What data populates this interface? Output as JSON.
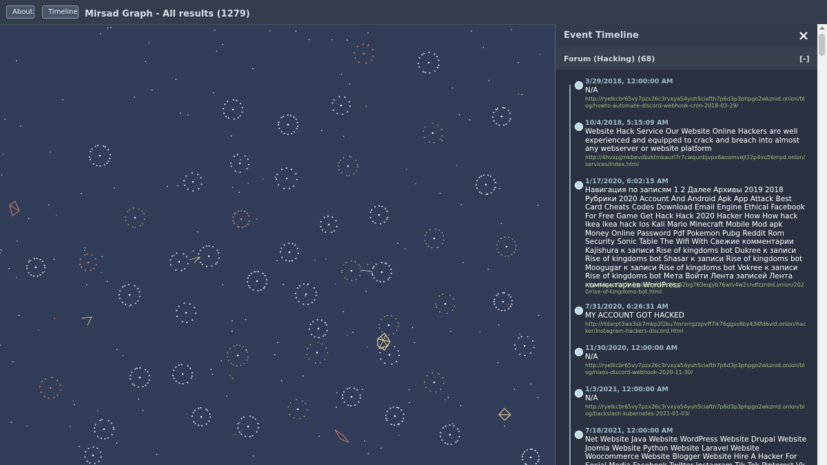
{
  "toolbar": {
    "about_label": "About",
    "timeline_label": "Timeline"
  },
  "header": {
    "title": "Mirsad Graph - All results (1279)"
  },
  "panel": {
    "title": "Event Timeline",
    "close_icon": "close-icon",
    "group": {
      "label": "Forum (Hacking) (68)",
      "toggle": "[-]"
    },
    "events": [
      {
        "date": "3/29/2018, 12:00:00 AM",
        "title": "N/A",
        "url": "http://ryelkcbr65vy7pzx26c3rvxya54yuh5ciafth7p6d3p3phpgo2wkznid.onion/blog/howto-automate-discord-webhook-cron-2018-03-29/"
      },
      {
        "date": "10/4/2018, 5:15:09 AM",
        "title": "Website Hack Service Our Website Online Hackers are well experienced and equipped to crack and breach into almost any webserver or website platform",
        "url": "http://4hvxpjjmkbevdbzktmkaurl7r7cwqunbjvpx6aoomvejl22p4vu56myd.onion/services/index.html"
      },
      {
        "date": "1/17/2020, 6:02:15 AM",
        "title": "Навигация по записям 1 2 Далее Архивы 2019 2018 Рубрики 2020 Account And Android Apk App Attack Best Card Cheats Codes Download Email Engine Ethical Facebook For Free Game Get Hack Hack 2020 Hacker How How hack Ikea Ikea hack Ios Kali Mario Minecraft Mobile Mod apk Money Online Password Pdf Pokemon Pubg Reddit Rom Security Sonic Table The Wifi With Свежие комментарии Kajishura к записи Rise of kingdoms bot Dukree к записи Rise of kingdoms bot Shasar к записи Rise of kingdoms bot Moogugar к записи Rise of kingdoms bot Vokree к записи Rise of kingdoms bot Мета Войти Лента записей Лента комментариев WordPress",
        "url": "http://dgqufltlj2h3rhbalvz6o6s7ilg32bg763eqjyb76wlv4w2cndfzzrdid.onion/2020/rise-of-kingdoms-bot.html"
      },
      {
        "date": "7/31/2020, 6:26:31 AM",
        "title": "MY ACCOUNT GOT HACKED",
        "url": "http://rtdxrpt3wx3sk7mkp2l2ku7mrvrrgzzpvff7ik76ggss6by434fd6vid.onion/hacker/instagram-hackers-discord.html"
      },
      {
        "date": "11/30/2020, 12:00:00 AM",
        "title": "N/A",
        "url": "http://ryelkcbr65vy7pzx26c3rvxya54yuh5ciafth7p6d3p3phpgo2wkznid.onion/blog/nixos-discord-webhook-2020-11-30/"
      },
      {
        "date": "1/3/2021, 12:00:00 AM",
        "title": "N/A",
        "url": "http://ryelkcbr65vy7pzx26c3rvxya54yuh5ciafth7p6d3p3phpgo2wkznid.onion/blog/backslash-kubernetes-2021-01-03/"
      },
      {
        "date": "7/18/2021, 12:00:00 AM",
        "title": "Net Website Java Website WordPress Website Drupal Website Joomla Website Python Website Laravel Website Woocommerce Website Blogger Website Hire A Hacker For Social Media Facebook Twitter Instagram Tik Tok Pinterest Vk QQ WeChat",
        "url": ""
      }
    ]
  },
  "graph": {
    "colors": {
      "background": "#313d59",
      "white_node": "#e6e9f0",
      "gold_node": "#d9c48a",
      "red_node": "#d9826a"
    }
  }
}
